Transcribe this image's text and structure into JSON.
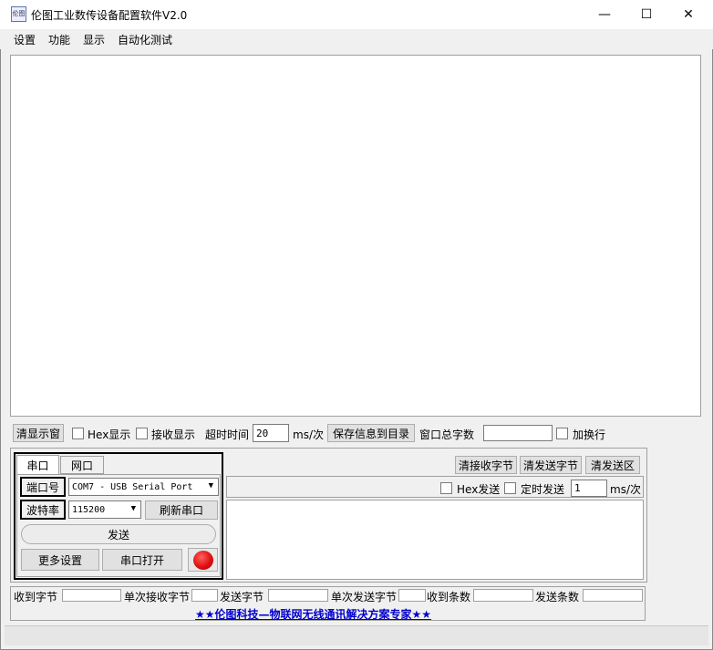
{
  "window": {
    "title": "伦图工业数传设备配置软件V2.0",
    "icon_text": "伦图",
    "minimize_label": "—",
    "maximize_label": "☐",
    "close_label": "✕"
  },
  "menu": {
    "items": [
      "设置",
      "功能",
      "显示",
      "自动化测试"
    ]
  },
  "receive_bar": {
    "clear_display": "清显示窗",
    "hex_display": "Hex显示",
    "recv_display": "接收显示",
    "timeout_label": "超时时间",
    "timeout_value": "20",
    "timeout_unit": "ms/次",
    "save_info": "保存信息到目录",
    "window_total_label": "窗口总字数",
    "window_total_value": "",
    "add_newline": "加换行"
  },
  "tabs": [
    "串口",
    "网口"
  ],
  "serial": {
    "port_label": "端口号",
    "port_value": "COM7 - USB Serial Port",
    "baud_label": "波特率",
    "baud_value": "115200",
    "refresh": "刷新串口",
    "send": "发送",
    "more_settings": "更多设置",
    "open_port": "串口打开"
  },
  "send_panel": {
    "clear_recv_bytes": "清接收字节",
    "clear_send_bytes": "清发送字节",
    "clear_send_area": "清发送区",
    "hex_send": "Hex发送",
    "timed_send": "定时发送",
    "interval_value": "1",
    "interval_unit": "ms/次"
  },
  "status": {
    "recv_bytes": "收到字节",
    "single_recv_bytes": "单次接收字节",
    "send_bytes": "发送字节",
    "single_send_bytes": "单次发送字节",
    "recv_count": "收到条数",
    "send_count": "发送条数"
  },
  "banner": "★★伦图科技—物联网无线通讯解决方案专家★★",
  "colors": {
    "indicator": "#e01010",
    "banner_text": "#0000cc"
  }
}
